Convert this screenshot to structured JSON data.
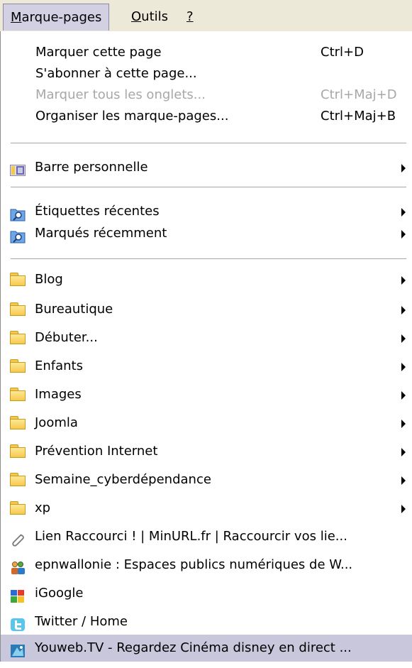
{
  "menubar": {
    "items": [
      {
        "mnemonic": "M",
        "rest": "arque-pages"
      },
      {
        "mnemonic": "O",
        "rest": "utils"
      },
      {
        "mnemonic": "?",
        "rest": ""
      }
    ]
  },
  "menu": {
    "actions": [
      {
        "label": "Marquer cette page",
        "shortcut": "Ctrl+D"
      },
      {
        "label": "S'abonner à cette page...",
        "shortcut": ""
      },
      {
        "label": "Marquer tous les onglets...",
        "shortcut": "Ctrl+Maj+D"
      },
      {
        "label": "Organiser les marque-pages...",
        "shortcut": "Ctrl+Maj+B"
      }
    ],
    "toolbar_item": {
      "label": "Barre personnelle",
      "icon": "toolbar-icon"
    },
    "smart_items": [
      {
        "label": "Étiquettes récentes",
        "icon": "smart-bookmark-icon"
      },
      {
        "label": "Marqués récemment",
        "icon": "smart-bookmark-icon"
      }
    ],
    "folders": [
      {
        "label": "Blog"
      },
      {
        "label": "Bureautique"
      },
      {
        "label": "Débuter..."
      },
      {
        "label": "Enfants"
      },
      {
        "label": "Images"
      },
      {
        "label": "Joomla"
      },
      {
        "label": "Prévention Internet"
      },
      {
        "label": "Semaine_cyberdépendance"
      },
      {
        "label": "xp"
      }
    ],
    "bookmarks": [
      {
        "label": "Lien Raccourci ! | MinURL.fr | Raccourcir vos lie...",
        "icon": "paperclip-icon"
      },
      {
        "label": "epnwallonie : Espaces publics numériques de W...",
        "icon": "people-icon"
      },
      {
        "label": "iGoogle",
        "icon": "igoogle-icon"
      },
      {
        "label": "Twitter / Home",
        "icon": "twitter-icon"
      },
      {
        "label": "Youweb.TV - Regardez Cinéma disney en direct ...",
        "icon": "youweb-icon"
      }
    ]
  },
  "colors": {
    "menubar_bg": "#ece9d8",
    "highlight_bg": "#c9c7dc",
    "disabled_text": "#a8a8a8",
    "folder_yellow": "#f6c94a"
  }
}
